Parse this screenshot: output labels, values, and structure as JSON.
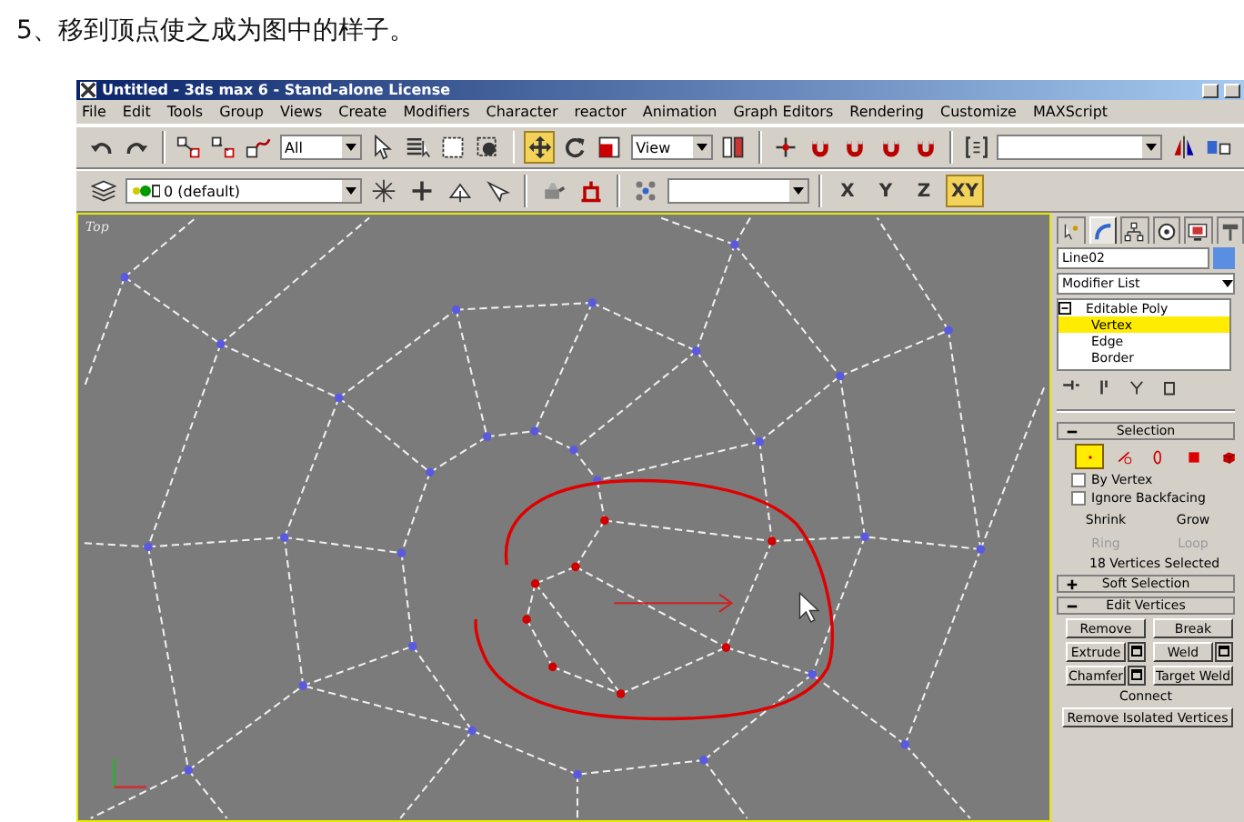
{
  "heading": "5、移到顶点使之成为图中的样子。",
  "window": {
    "title": "Untitled - 3ds max 6 - Stand-alone License"
  },
  "menu": [
    "File",
    "Edit",
    "Tools",
    "Group",
    "Views",
    "Create",
    "Modifiers",
    "Character",
    "reactor",
    "Animation",
    "Graph Editors",
    "Rendering",
    "Customize",
    "MAXScript"
  ],
  "main_toolbar": [
    {
      "kind": "undo",
      "selected": false
    },
    {
      "kind": "redo",
      "selected": false
    },
    {
      "kind": "sep"
    },
    {
      "kind": "link",
      "selected": false
    },
    {
      "kind": "unlink",
      "selected": false
    },
    {
      "kind": "bind",
      "selected": false
    },
    {
      "kind": "dropdown",
      "value": "All"
    },
    {
      "kind": "select",
      "selected": false
    },
    {
      "kind": "select-by-name",
      "selected": false
    },
    {
      "kind": "rect-region",
      "selected": false
    },
    {
      "kind": "window-crossing",
      "selected": false
    },
    {
      "kind": "sep"
    },
    {
      "kind": "move",
      "selected": true
    },
    {
      "kind": "rotate",
      "selected": false
    },
    {
      "kind": "scale",
      "selected": false
    },
    {
      "kind": "dropdown",
      "value": "View"
    },
    {
      "kind": "pivot",
      "selected": false
    },
    {
      "kind": "sep"
    },
    {
      "kind": "manipulate",
      "selected": false
    },
    {
      "kind": "snap",
      "selected": false
    },
    {
      "kind": "snap",
      "selected": false
    },
    {
      "kind": "snap",
      "selected": false
    },
    {
      "kind": "snap",
      "selected": false
    },
    {
      "kind": "sep"
    },
    {
      "kind": "named-selection",
      "selected": false
    },
    {
      "kind": "dropdown"
    },
    {
      "kind": "mirror",
      "selected": false
    },
    {
      "kind": "align",
      "selected": false
    }
  ],
  "layer_toolbar": [
    {
      "kind": "layers",
      "selected": false
    },
    {
      "kind": "dropdown",
      "value": "0 (default)"
    },
    {
      "kind": "layer-add",
      "selected": false
    },
    {
      "kind": "layer-select",
      "selected": false
    },
    {
      "kind": "layer-move",
      "selected": false
    },
    {
      "kind": "layer-props",
      "selected": false
    },
    {
      "kind": "sep"
    },
    {
      "kind": "teapot",
      "selected": false
    },
    {
      "kind": "render",
      "selected": false
    },
    {
      "kind": "sep"
    },
    {
      "kind": "dots",
      "selected": false
    },
    {
      "kind": "dropdown"
    },
    {
      "kind": "sep"
    }
  ],
  "axis_constraints": [
    {
      "label": "X",
      "selected": false
    },
    {
      "label": "Y",
      "selected": false
    },
    {
      "label": "Z",
      "selected": false
    },
    {
      "label": "XY",
      "selected": true
    }
  ],
  "viewport": {
    "label": "Top"
  },
  "command_panel": {
    "tabs": [
      {
        "kind": "create",
        "selected": false
      },
      {
        "kind": "modify",
        "selected": true
      },
      {
        "kind": "hierarchy",
        "selected": false
      },
      {
        "kind": "motion",
        "selected": false
      },
      {
        "kind": "display",
        "selected": false
      },
      {
        "kind": "utilities",
        "selected": false
      }
    ],
    "object_name": "Line02",
    "modifier_list": "Modifier List",
    "stack": [
      {
        "label": "Editable Poly",
        "selected": false,
        "children": [
          {
            "label": "Vertex",
            "selected": true
          },
          {
            "label": "Edge",
            "selected": false
          },
          {
            "label": "Border",
            "selected": false
          }
        ]
      }
    ],
    "selection_rollout": {
      "title": "Selection",
      "expanded": true,
      "levels": [
        {
          "kind": "vertex",
          "selected": true
        },
        {
          "kind": "edge",
          "selected": false
        },
        {
          "kind": "border",
          "selected": false
        },
        {
          "kind": "polygon",
          "selected": false
        },
        {
          "kind": "element",
          "selected": false
        }
      ],
      "options": [
        {
          "label": "By Vertex",
          "checked": false
        },
        {
          "label": "Ignore Backfacing",
          "checked": false
        }
      ],
      "buttons": [
        {
          "label": "Shrink",
          "disabled": false
        },
        {
          "label": "Grow",
          "disabled": false
        },
        {
          "label": "Ring",
          "disabled": true
        },
        {
          "label": "Loop",
          "disabled": true
        }
      ],
      "status": "18 Vertices Selected"
    },
    "rollouts": [
      {
        "title": "Soft Selection",
        "expanded": false
      },
      {
        "title": "Edit Vertices",
        "expanded": true
      }
    ],
    "edit_vertices": {
      "buttons": [
        {
          "label": "Remove",
          "settings": false
        },
        {
          "label": "Break",
          "settings": false
        },
        {
          "label": "Extrude",
          "settings": true
        },
        {
          "label": "Weld",
          "settings": true
        },
        {
          "label": "Chamfer",
          "settings": true
        },
        {
          "label": "Target Weld",
          "settings": false
        }
      ],
      "connect": "Connect",
      "wide_button": "Remove Isolated Vertices"
    }
  }
}
